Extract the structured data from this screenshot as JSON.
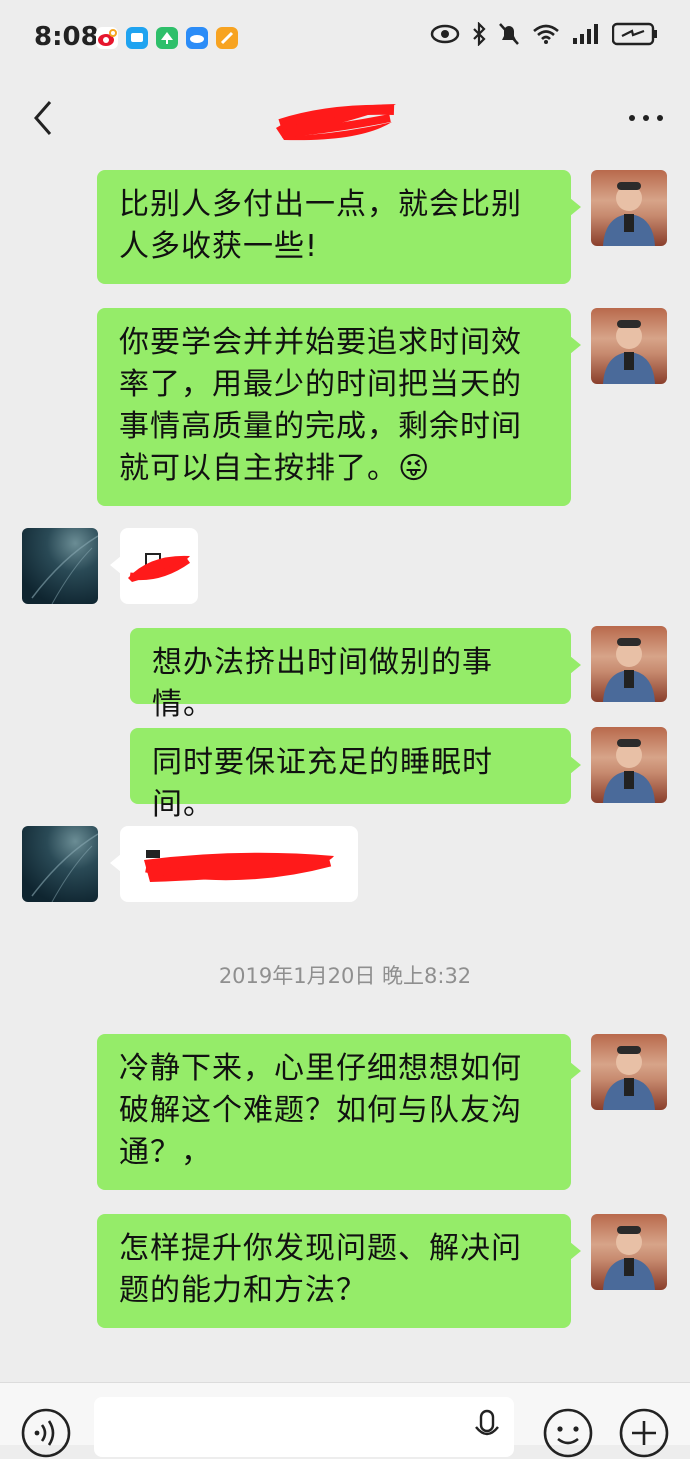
{
  "status_bar": {
    "time": "8:08",
    "notification_icons": [
      "weibo-icon",
      "chat-app-icon",
      "tree-app-icon",
      "cloud-app-icon",
      "orange-app-icon"
    ],
    "system_icons": [
      "eye-icon",
      "bluetooth-icon",
      "mute-bell-icon",
      "wifi-icon",
      "signal-icon",
      "battery-icon"
    ]
  },
  "nav": {
    "back_icon": "chevron-left-icon",
    "more_icon": "more-dots-icon",
    "title_redacted": true
  },
  "messages": [
    {
      "side": "me",
      "text": "比别人多付出一点，就会比别人多收获一些!",
      "lines": [
        "比别人多付出一点，就会比别",
        "人多收获一些!"
      ]
    },
    {
      "side": "me",
      "text": "你要学会并并始要追求时间效率了，用最少的时间把当天的事情高质量的完成，剩余时间就可以自主按排了。",
      "lines": [
        "你要学会并并始要追求时间效",
        "率了，用最少的时间把当天的",
        "事情高质量的完成，剩余时间",
        "就可以自主按排了。"
      ],
      "emoji": "😜"
    },
    {
      "side": "other",
      "redacted": true
    },
    {
      "side": "me",
      "text": "想办法挤出时间做别的事情。"
    },
    {
      "side": "me",
      "text": "同时要保证充足的睡眠时间。"
    },
    {
      "side": "other",
      "redacted": true
    },
    {
      "side": "me",
      "text": "冷静下来，心里仔细想想如何破解这个难题？如何与队友沟通？，",
      "lines": [
        "冷静下来，心里仔细想想如何",
        "破解这个难题？如何与队友沟",
        "通？，"
      ]
    },
    {
      "side": "me",
      "text": "怎样提升你发现问题、解决问题的能力和方法？",
      "lines": [
        "怎样提升你发现问题、解决问",
        "题的能力和方法？"
      ]
    }
  ],
  "timestamp": "2019年1月20日 晚上8:32",
  "input_bar": {
    "voice_icon": "voice-icon",
    "mic_icon": "mic-icon",
    "emoji_icon": "emoji-icon",
    "plus_icon": "plus-icon"
  },
  "colors": {
    "my_bubble": "#95ec69",
    "other_bubble": "#ffffff",
    "background": "#ededed",
    "redaction": "#ff0000"
  }
}
